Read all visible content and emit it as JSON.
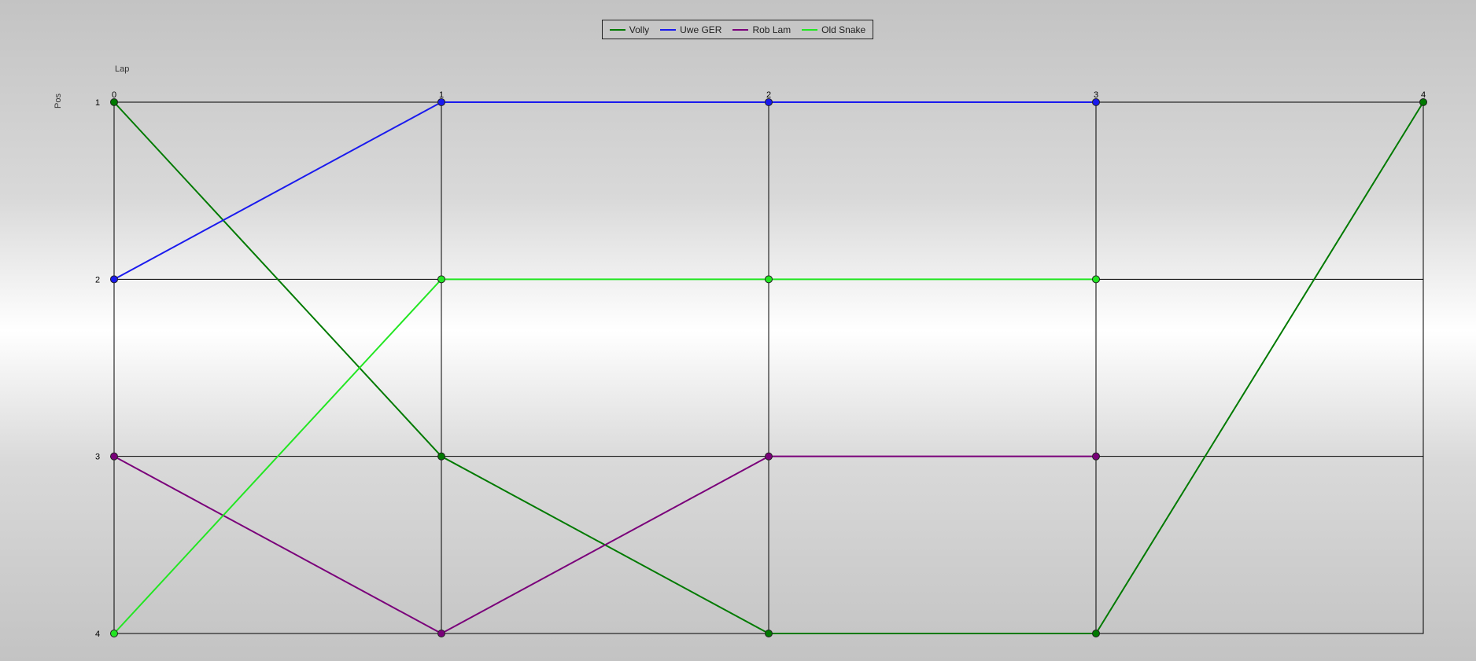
{
  "legend": {
    "items": [
      {
        "label": "Volly",
        "color": "#007a00"
      },
      {
        "label": "Uwe GER",
        "color": "#1a1aee"
      },
      {
        "label": "Rob Lam",
        "color": "#7a007a"
      },
      {
        "label": "Old Snake",
        "color": "#22e622"
      }
    ]
  },
  "axes": {
    "x_title": "Lap",
    "y_title": "Pos"
  },
  "chart_data": {
    "type": "line",
    "title": "",
    "xlabel": "Lap",
    "ylabel": "Pos",
    "x": [
      0,
      1,
      2,
      3,
      4
    ],
    "xlim": [
      0,
      4
    ],
    "ylim": [
      1,
      4
    ],
    "y_inverted": true,
    "x_axis_position": "top",
    "grid": true,
    "legend_position": "top-center",
    "series": [
      {
        "name": "Volly",
        "color": "#007a00",
        "values": [
          1,
          3,
          4,
          4,
          1
        ]
      },
      {
        "name": "Uwe GER",
        "color": "#1a1aee",
        "values": [
          2,
          1,
          1,
          1,
          null
        ]
      },
      {
        "name": "Rob Lam",
        "color": "#7a007a",
        "values": [
          3,
          4,
          3,
          3,
          null
        ]
      },
      {
        "name": "Old Snake",
        "color": "#22e622",
        "values": [
          4,
          2,
          2,
          2,
          null
        ]
      }
    ]
  }
}
